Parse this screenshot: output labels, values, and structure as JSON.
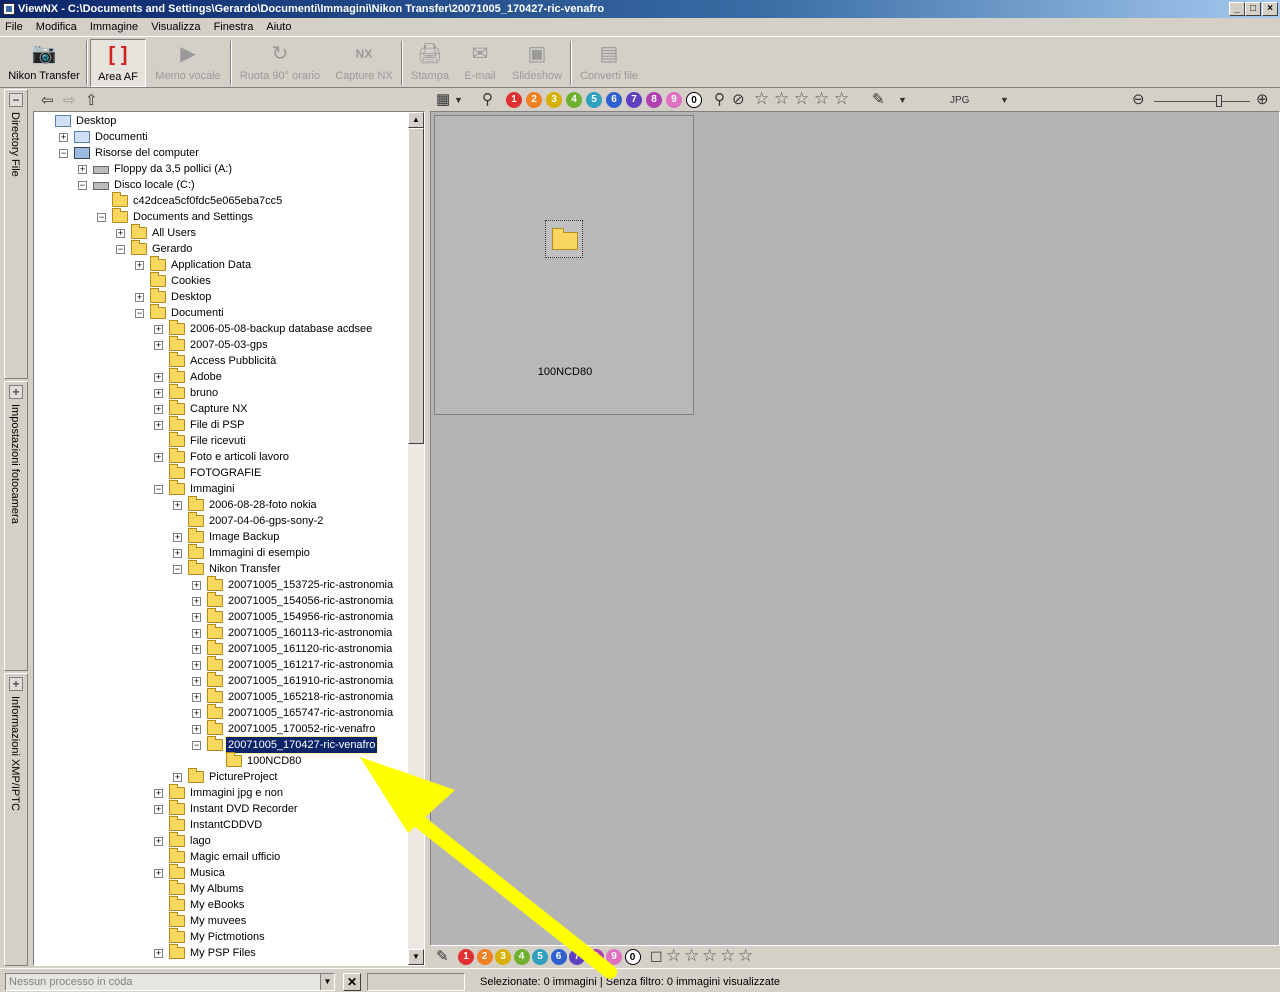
{
  "window": {
    "title": "ViewNX - C:\\Documents and Settings\\Gerardo\\Documenti\\Immagini\\Nikon Transfer\\20071005_170427-ric-venafro",
    "minimize": "_",
    "maximize": "□",
    "close": "×"
  },
  "menu": [
    "File",
    "Modifica",
    "Immagine",
    "Visualizza",
    "Finestra",
    "Aiuto"
  ],
  "toolbar": [
    {
      "label": "Nikon Transfer",
      "icon": "📷",
      "enabled": true
    },
    {
      "label": "Area AF",
      "icon": "[ ]",
      "enabled": true,
      "active": true
    },
    {
      "label": "Memo vocale",
      "icon": "▶",
      "enabled": false
    },
    {
      "label": "Ruota 90° orario",
      "icon": "↻",
      "enabled": false
    },
    {
      "label": "Capture NX",
      "icon": "NX",
      "enabled": false
    },
    {
      "label": "Stampa",
      "icon": "🖨",
      "enabled": false
    },
    {
      "label": "E-mail",
      "icon": "✉",
      "enabled": false
    },
    {
      "label": "Slideshow",
      "icon": "▣",
      "enabled": false
    },
    {
      "label": "Converti file",
      "icon": "▤",
      "enabled": false
    }
  ],
  "side_tabs": [
    "Directory File",
    "Impostazioni fotocamera",
    "Informazioni XMP/IPTC"
  ],
  "tree": [
    {
      "label": "Desktop",
      "level": 0,
      "exp": "",
      "icon": "special"
    },
    {
      "label": "Documenti",
      "level": 1,
      "exp": "+",
      "icon": "special"
    },
    {
      "label": "Risorse del computer",
      "level": 1,
      "exp": "-",
      "icon": "computer"
    },
    {
      "label": "Floppy da 3,5 pollici (A:)",
      "level": 2,
      "exp": "+",
      "icon": "drive"
    },
    {
      "label": "Disco locale (C:)",
      "level": 2,
      "exp": "-",
      "icon": "drive"
    },
    {
      "label": "c42dcea5cf0fdc5e065eba7cc5",
      "level": 3,
      "exp": "",
      "icon": "folder"
    },
    {
      "label": "Documents and Settings",
      "level": 3,
      "exp": "-",
      "icon": "folder"
    },
    {
      "label": "All Users",
      "level": 4,
      "exp": "+",
      "icon": "folder"
    },
    {
      "label": "Gerardo",
      "level": 4,
      "exp": "-",
      "icon": "folder"
    },
    {
      "label": "Application Data",
      "level": 5,
      "exp": "+",
      "icon": "folder"
    },
    {
      "label": "Cookies",
      "level": 5,
      "exp": "",
      "icon": "folder"
    },
    {
      "label": "Desktop",
      "level": 5,
      "exp": "+",
      "icon": "folder"
    },
    {
      "label": "Documenti",
      "level": 5,
      "exp": "-",
      "icon": "folder"
    },
    {
      "label": "2006-05-08-backup database acdsee",
      "level": 6,
      "exp": "+",
      "icon": "folder"
    },
    {
      "label": "2007-05-03-gps",
      "level": 6,
      "exp": "+",
      "icon": "folder"
    },
    {
      "label": "Access Pubblicità",
      "level": 6,
      "exp": "",
      "icon": "folder"
    },
    {
      "label": "Adobe",
      "level": 6,
      "exp": "+",
      "icon": "folder"
    },
    {
      "label": "bruno",
      "level": 6,
      "exp": "+",
      "icon": "folder"
    },
    {
      "label": "Capture NX",
      "level": 6,
      "exp": "+",
      "icon": "folder"
    },
    {
      "label": "File di PSP",
      "level": 6,
      "exp": "+",
      "icon": "folder"
    },
    {
      "label": "File ricevuti",
      "level": 6,
      "exp": "",
      "icon": "folder"
    },
    {
      "label": "Foto e articoli lavoro",
      "level": 6,
      "exp": "+",
      "icon": "folder"
    },
    {
      "label": "FOTOGRAFIE",
      "level": 6,
      "exp": "",
      "icon": "folder"
    },
    {
      "label": "Immagini",
      "level": 6,
      "exp": "-",
      "icon": "folder"
    },
    {
      "label": "2006-08-28-foto nokia",
      "level": 7,
      "exp": "+",
      "icon": "folder"
    },
    {
      "label": "2007-04-06-gps-sony-2",
      "level": 7,
      "exp": "",
      "icon": "folder"
    },
    {
      "label": "Image Backup",
      "level": 7,
      "exp": "+",
      "icon": "folder"
    },
    {
      "label": "Immagini di esempio",
      "level": 7,
      "exp": "+",
      "icon": "folder"
    },
    {
      "label": "Nikon Transfer",
      "level": 7,
      "exp": "-",
      "icon": "folder"
    },
    {
      "label": "20071005_153725-ric-astronomia",
      "level": 8,
      "exp": "+",
      "icon": "folder"
    },
    {
      "label": "20071005_154056-ric-astronomia",
      "level": 8,
      "exp": "+",
      "icon": "folder"
    },
    {
      "label": "20071005_154956-ric-astronomia",
      "level": 8,
      "exp": "+",
      "icon": "folder"
    },
    {
      "label": "20071005_160113-ric-astronomia",
      "level": 8,
      "exp": "+",
      "icon": "folder"
    },
    {
      "label": "20071005_161120-ric-astronomia",
      "level": 8,
      "exp": "+",
      "icon": "folder"
    },
    {
      "label": "20071005_161217-ric-astronomia",
      "level": 8,
      "exp": "+",
      "icon": "folder"
    },
    {
      "label": "20071005_161910-ric-astronomia",
      "level": 8,
      "exp": "+",
      "icon": "folder"
    },
    {
      "label": "20071005_165218-ric-astronomia",
      "level": 8,
      "exp": "+",
      "icon": "folder"
    },
    {
      "label": "20071005_165747-ric-astronomia",
      "level": 8,
      "exp": "+",
      "icon": "folder"
    },
    {
      "label": "20071005_170052-ric-venafro",
      "level": 8,
      "exp": "+",
      "icon": "folder"
    },
    {
      "label": "20071005_170427-ric-venafro",
      "level": 8,
      "exp": "-",
      "icon": "folder",
      "selected": true
    },
    {
      "label": "100NCD80",
      "level": 9,
      "exp": "",
      "icon": "folder"
    },
    {
      "label": "PictureProject",
      "level": 7,
      "exp": "+",
      "icon": "folder"
    },
    {
      "label": "Immagini jpg e non",
      "level": 6,
      "exp": "+",
      "icon": "folder"
    },
    {
      "label": "Instant DVD Recorder",
      "level": 6,
      "exp": "+",
      "icon": "folder"
    },
    {
      "label": "InstantCDDVD",
      "level": 6,
      "exp": "",
      "icon": "folder"
    },
    {
      "label": "lago",
      "level": 6,
      "exp": "+",
      "icon": "folder"
    },
    {
      "label": "Magic email ufficio",
      "level": 6,
      "exp": "",
      "icon": "folder"
    },
    {
      "label": "Musica",
      "level": 6,
      "exp": "+",
      "icon": "folder"
    },
    {
      "label": "My Albums",
      "level": 6,
      "exp": "",
      "icon": "folder"
    },
    {
      "label": "My eBooks",
      "level": 6,
      "exp": "",
      "icon": "folder"
    },
    {
      "label": "My muvees",
      "level": 6,
      "exp": "",
      "icon": "folder"
    },
    {
      "label": "My Pictmotions",
      "level": 6,
      "exp": "",
      "icon": "folder"
    },
    {
      "label": "My PSP Files",
      "level": 6,
      "exp": "+",
      "icon": "folder"
    }
  ],
  "labels": [
    {
      "n": "1",
      "color": "#e03030"
    },
    {
      "n": "2",
      "color": "#f08020"
    },
    {
      "n": "3",
      "color": "#d8b000"
    },
    {
      "n": "4",
      "color": "#70b030"
    },
    {
      "n": "5",
      "color": "#30a0c0"
    },
    {
      "n": "6",
      "color": "#3060d0"
    },
    {
      "n": "7",
      "color": "#6040c0"
    },
    {
      "n": "8",
      "color": "#b040b0"
    },
    {
      "n": "9",
      "color": "#e070c0"
    },
    {
      "n": "0",
      "color": "#ffffff"
    }
  ],
  "format_label": "JPG",
  "thumbnail": {
    "name": "100NCD80"
  },
  "status": {
    "queue_placeholder": "Nessun processo in coda",
    "text": "Selezionate: 0 immagini | Senza filtro: 0 immagini visualizzate"
  },
  "colors": {
    "selection": "#0a246a",
    "annotation_arrow": "#ffff00"
  }
}
